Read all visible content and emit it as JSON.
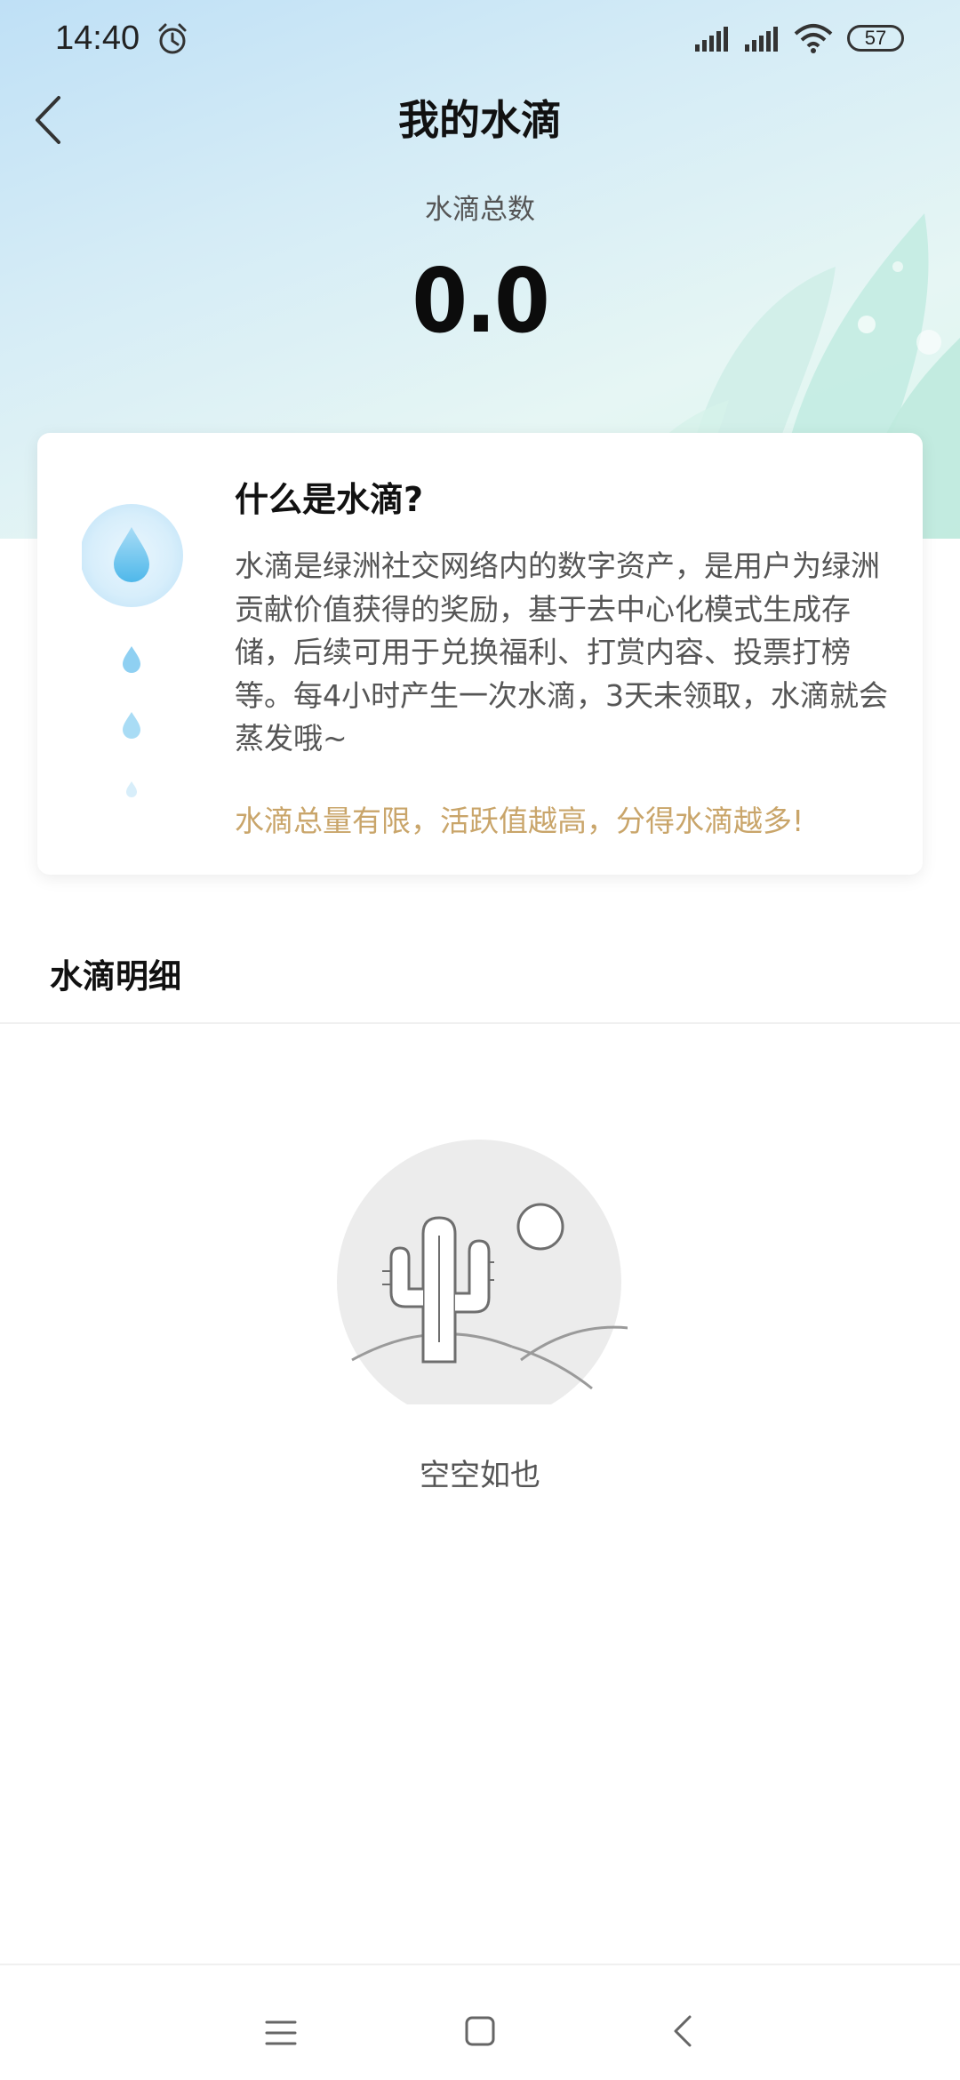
{
  "status_bar": {
    "time": "14:40",
    "battery": "57",
    "icons": [
      "alarm-icon",
      "signal-icon",
      "signal-icon",
      "wifi-icon",
      "battery-icon"
    ]
  },
  "header": {
    "title": "我的水滴",
    "back_icon": "chevron-left-icon"
  },
  "summary": {
    "label": "水滴总数",
    "value": "0.0"
  },
  "info_card": {
    "title": "什么是水滴?",
    "description": "水滴是绿洲社交网络内的数字资产，是用户为绿洲贡献价值获得的奖励，基于去中心化模式生成存储，后续可用于兑换福利、打赏内容、投票打榜等。每4小时产生一次水滴，3天未领取，水滴就会蒸发哦~",
    "highlight": "水滴总量有限，活跃值越高，分得水滴越多!",
    "highlight_color": "#c9a56a",
    "icon": "water-drop-icon"
  },
  "details": {
    "section_title": "水滴明细",
    "empty_text": "空空如也",
    "empty_icon": "cactus-desert-icon"
  },
  "system_nav": {
    "icons": [
      "menu-icon",
      "home-icon",
      "back-icon"
    ]
  }
}
